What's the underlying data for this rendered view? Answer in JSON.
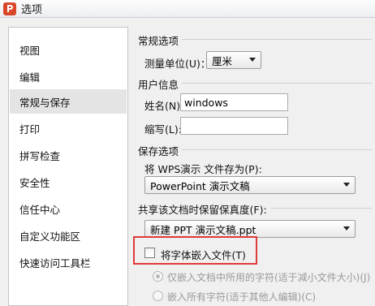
{
  "window": {
    "title": "选项"
  },
  "sidebar": {
    "items": [
      {
        "label": "视图"
      },
      {
        "label": "编辑"
      },
      {
        "label": "常规与保存"
      },
      {
        "label": "打印"
      },
      {
        "label": "拼写检查"
      },
      {
        "label": "安全性"
      },
      {
        "label": "信任中心"
      },
      {
        "label": "自定义功能区"
      },
      {
        "label": "快速访问工具栏"
      }
    ]
  },
  "general": {
    "section_title": "常规选项",
    "unit_label": "测量单位(U)：",
    "unit_value": "厘米"
  },
  "user_info": {
    "section_title": "用户信息",
    "name_label": "姓名(N):",
    "name_value": "windows",
    "abbr_label": "缩写(L):",
    "abbr_value": ""
  },
  "save": {
    "section_title": "保存选项",
    "save_as_label": "将 WPS演示 文件存为(P):",
    "save_as_value": "PowerPoint 演示文稿"
  },
  "share": {
    "section_title": "共享该文档时保留保真度(F):",
    "doc_value": "新建 PPT 演示文稿.ppt",
    "embed_fonts_label": "将字体嵌入文件(T)",
    "embed_used_label": "仅嵌入文档中所用的字符(适于减小文件大小)(J)",
    "embed_all_label": "嵌入所有字符(适于其他人编辑)(C)"
  },
  "colors": {
    "highlight": "#e03a3a",
    "selected_item": "#e4e4e4",
    "app_icon": "#d9472b"
  }
}
